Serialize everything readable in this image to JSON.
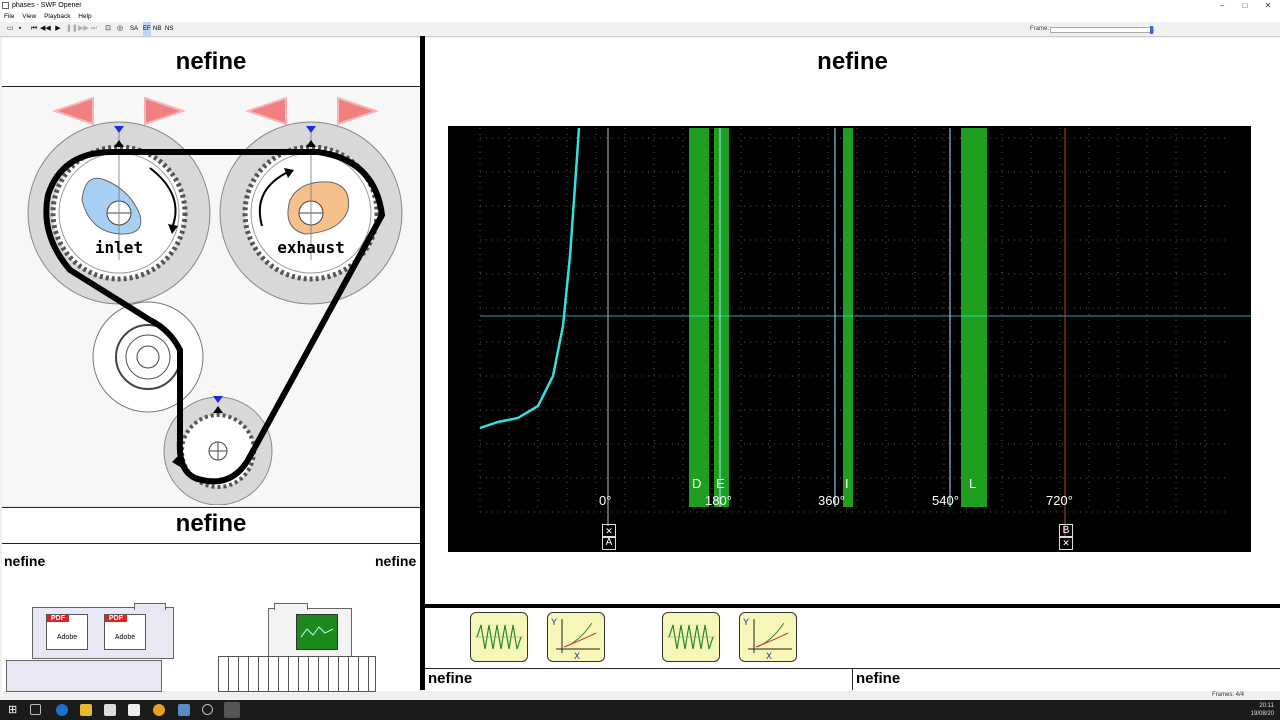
{
  "window": {
    "title": "phases - SWF Opener",
    "min": "–",
    "max": "□",
    "close": "✕"
  },
  "menu": {
    "file": "File",
    "view": "View",
    "playback": "Playback",
    "help": "Help"
  },
  "toolbar": {
    "sa": "SA",
    "ef": "EF",
    "nb": "NB",
    "ns": "NS",
    "frame_label": "Frame:",
    "frame_value": 1.0
  },
  "left_panel": {
    "title": "nefine",
    "inlet_label": "inlet",
    "exhaust_label": "exhaust"
  },
  "left_lower": {
    "title": "nefine",
    "left_label": "nefine",
    "right_label": "nefine",
    "pdf_text": "PDF",
    "adobe_text": "Adobe"
  },
  "right_panel": {
    "title": "nefine"
  },
  "scope": {
    "markers": [
      "D",
      "E",
      "I",
      "L"
    ],
    "ticks": [
      "0°",
      "180°",
      "360°",
      "540°",
      "720°"
    ],
    "cursor_a": "A",
    "cursor_b": "B"
  },
  "footer": {
    "left": "nefine",
    "right": "nefine"
  },
  "status": {
    "frames": "Frames: 4/4"
  },
  "clock": {
    "time": "20:11",
    "date": "19/08/20"
  },
  "colors": {
    "trace": "#33e0e0",
    "band": "#1f9e1f",
    "grid": "#5a5a5a",
    "inlet_cam": "#a8d0f5",
    "exhaust_cam": "#f5c08a",
    "arrow": "#f08080"
  }
}
